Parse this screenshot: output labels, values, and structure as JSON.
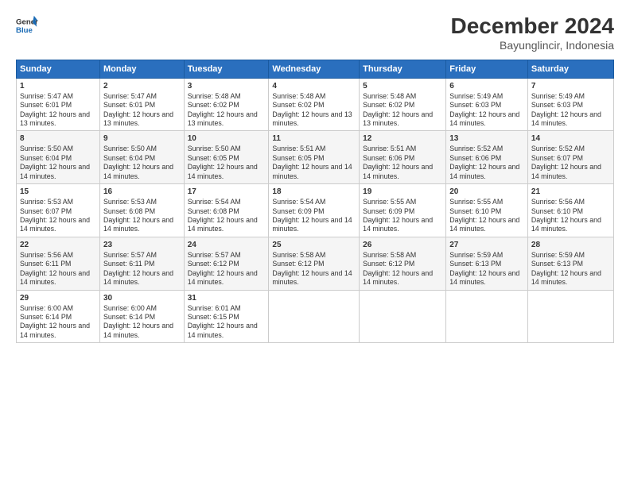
{
  "logo": {
    "line1": "General",
    "line2": "Blue"
  },
  "title": "December 2024",
  "subtitle": "Bayunglincir, Indonesia",
  "days_header": [
    "Sunday",
    "Monday",
    "Tuesday",
    "Wednesday",
    "Thursday",
    "Friday",
    "Saturday"
  ],
  "weeks": [
    [
      {
        "day": "1",
        "sunrise": "5:47 AM",
        "sunset": "6:01 PM",
        "daylight": "12 hours and 13 minutes."
      },
      {
        "day": "2",
        "sunrise": "5:47 AM",
        "sunset": "6:01 PM",
        "daylight": "12 hours and 13 minutes."
      },
      {
        "day": "3",
        "sunrise": "5:48 AM",
        "sunset": "6:02 PM",
        "daylight": "12 hours and 13 minutes."
      },
      {
        "day": "4",
        "sunrise": "5:48 AM",
        "sunset": "6:02 PM",
        "daylight": "12 hours and 13 minutes."
      },
      {
        "day": "5",
        "sunrise": "5:48 AM",
        "sunset": "6:02 PM",
        "daylight": "12 hours and 13 minutes."
      },
      {
        "day": "6",
        "sunrise": "5:49 AM",
        "sunset": "6:03 PM",
        "daylight": "12 hours and 14 minutes."
      },
      {
        "day": "7",
        "sunrise": "5:49 AM",
        "sunset": "6:03 PM",
        "daylight": "12 hours and 14 minutes."
      }
    ],
    [
      {
        "day": "8",
        "sunrise": "5:50 AM",
        "sunset": "6:04 PM",
        "daylight": "12 hours and 14 minutes."
      },
      {
        "day": "9",
        "sunrise": "5:50 AM",
        "sunset": "6:04 PM",
        "daylight": "12 hours and 14 minutes."
      },
      {
        "day": "10",
        "sunrise": "5:50 AM",
        "sunset": "6:05 PM",
        "daylight": "12 hours and 14 minutes."
      },
      {
        "day": "11",
        "sunrise": "5:51 AM",
        "sunset": "6:05 PM",
        "daylight": "12 hours and 14 minutes."
      },
      {
        "day": "12",
        "sunrise": "5:51 AM",
        "sunset": "6:06 PM",
        "daylight": "12 hours and 14 minutes."
      },
      {
        "day": "13",
        "sunrise": "5:52 AM",
        "sunset": "6:06 PM",
        "daylight": "12 hours and 14 minutes."
      },
      {
        "day": "14",
        "sunrise": "5:52 AM",
        "sunset": "6:07 PM",
        "daylight": "12 hours and 14 minutes."
      }
    ],
    [
      {
        "day": "15",
        "sunrise": "5:53 AM",
        "sunset": "6:07 PM",
        "daylight": "12 hours and 14 minutes."
      },
      {
        "day": "16",
        "sunrise": "5:53 AM",
        "sunset": "6:08 PM",
        "daylight": "12 hours and 14 minutes."
      },
      {
        "day": "17",
        "sunrise": "5:54 AM",
        "sunset": "6:08 PM",
        "daylight": "12 hours and 14 minutes."
      },
      {
        "day": "18",
        "sunrise": "5:54 AM",
        "sunset": "6:09 PM",
        "daylight": "12 hours and 14 minutes."
      },
      {
        "day": "19",
        "sunrise": "5:55 AM",
        "sunset": "6:09 PM",
        "daylight": "12 hours and 14 minutes."
      },
      {
        "day": "20",
        "sunrise": "5:55 AM",
        "sunset": "6:10 PM",
        "daylight": "12 hours and 14 minutes."
      },
      {
        "day": "21",
        "sunrise": "5:56 AM",
        "sunset": "6:10 PM",
        "daylight": "12 hours and 14 minutes."
      }
    ],
    [
      {
        "day": "22",
        "sunrise": "5:56 AM",
        "sunset": "6:11 PM",
        "daylight": "12 hours and 14 minutes."
      },
      {
        "day": "23",
        "sunrise": "5:57 AM",
        "sunset": "6:11 PM",
        "daylight": "12 hours and 14 minutes."
      },
      {
        "day": "24",
        "sunrise": "5:57 AM",
        "sunset": "6:12 PM",
        "daylight": "12 hours and 14 minutes."
      },
      {
        "day": "25",
        "sunrise": "5:58 AM",
        "sunset": "6:12 PM",
        "daylight": "12 hours and 14 minutes."
      },
      {
        "day": "26",
        "sunrise": "5:58 AM",
        "sunset": "6:12 PM",
        "daylight": "12 hours and 14 minutes."
      },
      {
        "day": "27",
        "sunrise": "5:59 AM",
        "sunset": "6:13 PM",
        "daylight": "12 hours and 14 minutes."
      },
      {
        "day": "28",
        "sunrise": "5:59 AM",
        "sunset": "6:13 PM",
        "daylight": "12 hours and 14 minutes."
      }
    ],
    [
      {
        "day": "29",
        "sunrise": "6:00 AM",
        "sunset": "6:14 PM",
        "daylight": "12 hours and 14 minutes."
      },
      {
        "day": "30",
        "sunrise": "6:00 AM",
        "sunset": "6:14 PM",
        "daylight": "12 hours and 14 minutes."
      },
      {
        "day": "31",
        "sunrise": "6:01 AM",
        "sunset": "6:15 PM",
        "daylight": "12 hours and 14 minutes."
      },
      null,
      null,
      null,
      null
    ]
  ]
}
